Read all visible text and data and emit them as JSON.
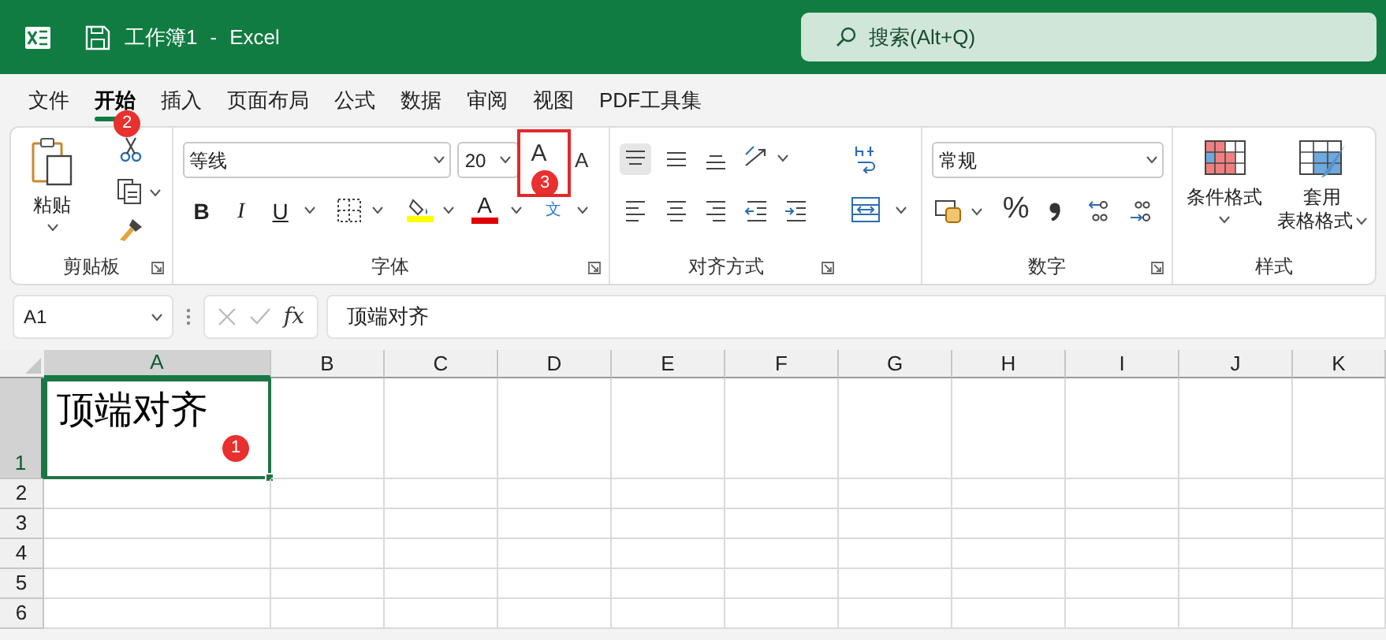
{
  "window": {
    "title": "工作簿1",
    "separator": "-",
    "app": "Excel"
  },
  "search": {
    "placeholder": "搜索(Alt+Q)"
  },
  "menu": [
    {
      "label": "文件",
      "selected": false
    },
    {
      "label": "开始",
      "selected": true
    },
    {
      "label": "插入",
      "selected": false
    },
    {
      "label": "页面布局",
      "selected": false
    },
    {
      "label": "公式",
      "selected": false
    },
    {
      "label": "数据",
      "selected": false
    },
    {
      "label": "审阅",
      "selected": false
    },
    {
      "label": "视图",
      "selected": false
    },
    {
      "label": "PDF工具集",
      "selected": false
    }
  ],
  "ribbon": {
    "clipboard": {
      "paste": "粘贴",
      "label": "剪贴板"
    },
    "font": {
      "font_name": "等线",
      "font_size": "20",
      "grow": "A",
      "shrink": "A",
      "bold": "B",
      "italic": "I",
      "underline": "U",
      "font_color": "A",
      "phonetic": "文",
      "label": "字体"
    },
    "alignment": {
      "top_align_on": true,
      "label": "对齐方式"
    },
    "number": {
      "format": "常规",
      "percent": "%",
      "label": "数字"
    },
    "styles": {
      "conditional": "条件格式",
      "table_top": "套用",
      "table_bottom": "表格格式",
      "label": "样式"
    }
  },
  "formula_bar": {
    "name_box": "A1",
    "fx": "fx",
    "formula": "顶端对齐"
  },
  "sheet": {
    "columns": [
      {
        "label": "A",
        "selected": true
      },
      {
        "label": "B",
        "selected": false
      },
      {
        "label": "C",
        "selected": false
      },
      {
        "label": "D",
        "selected": false
      },
      {
        "label": "E",
        "selected": false
      },
      {
        "label": "F",
        "selected": false
      },
      {
        "label": "G",
        "selected": false
      },
      {
        "label": "H",
        "selected": false
      },
      {
        "label": "I",
        "selected": false
      },
      {
        "label": "J",
        "selected": false
      },
      {
        "label": "K",
        "selected": false
      }
    ],
    "rows": [
      {
        "header": "1",
        "selected": true,
        "cells": [
          {
            "text": "顶端对齐",
            "selected": true
          }
        ]
      },
      {
        "header": "2",
        "selected": false
      },
      {
        "header": "3",
        "selected": false
      },
      {
        "header": "4",
        "selected": false
      },
      {
        "header": "5",
        "selected": false
      },
      {
        "header": "6",
        "selected": false
      }
    ]
  },
  "annotations": [
    {
      "label": "1"
    },
    {
      "label": "2"
    },
    {
      "label": "3"
    }
  ]
}
